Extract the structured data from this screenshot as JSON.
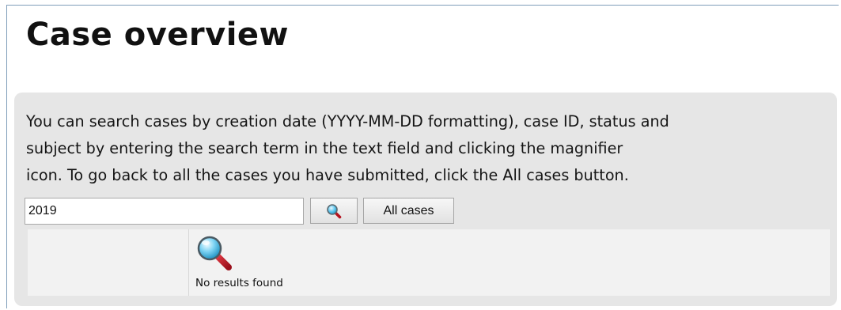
{
  "page": {
    "title": "Case overview"
  },
  "search": {
    "help_text": "You can search cases by creation date (YYYY-MM-DD formatting), case ID, status and\nsubject by entering the search term in the text field and clicking the magnifier\nicon. To go back to all the cases you have submitted, click the All cases button.",
    "value": "2019",
    "search_icon": "magnifier-icon",
    "all_cases_label": "All cases"
  },
  "results": {
    "empty_icon": "magnifier-icon",
    "empty_message": "No results found"
  },
  "colors": {
    "panel_background": "#e6e6e6",
    "results_background": "#f2f2f2",
    "magnifier_lens": "#2aa8d8",
    "magnifier_handle": "#c0152a"
  }
}
